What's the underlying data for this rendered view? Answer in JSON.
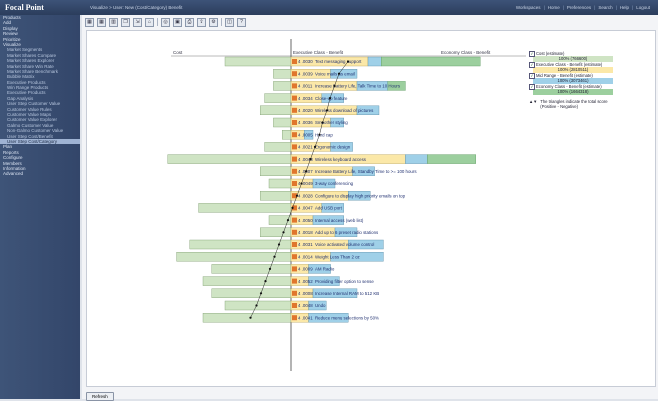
{
  "app": {
    "title": "Focal Point"
  },
  "breadcrumb": "Visualize > User: New (Cost/Category) Benefit",
  "top_links": [
    "Workspaces",
    "Home",
    "Preferences",
    "Search",
    "Help",
    "Logout"
  ],
  "sidebar": [
    {
      "label": "Products",
      "sub": false
    },
    {
      "label": "Add",
      "sub": false
    },
    {
      "label": "Display",
      "sub": false
    },
    {
      "label": "Review",
      "sub": false
    },
    {
      "label": "Prioritize",
      "sub": false
    },
    {
      "label": "Visualize",
      "sub": false
    },
    {
      "label": "Market Segments",
      "sub": true
    },
    {
      "label": "Market Shares Compare",
      "sub": true
    },
    {
      "label": "Market Shares Explorer",
      "sub": true
    },
    {
      "label": "Market Share Win Rate",
      "sub": true
    },
    {
      "label": "Market Share Benchmark",
      "sub": true
    },
    {
      "label": "Bubble Matrix",
      "sub": true
    },
    {
      "label": "Executive Products",
      "sub": true
    },
    {
      "label": "Win Range Products",
      "sub": true
    },
    {
      "label": "Executive Products",
      "sub": true
    },
    {
      "label": "Gap Analysis",
      "sub": true
    },
    {
      "label": "User Step Customer Value",
      "sub": true
    },
    {
      "label": "Customer Value Rules",
      "sub": true
    },
    {
      "label": "Customer Value Maps",
      "sub": true
    },
    {
      "label": "Customer Value Explorer",
      "sub": true
    },
    {
      "label": "Galmo Customer Value",
      "sub": true
    },
    {
      "label": "Non-Galmo Customer Value",
      "sub": true
    },
    {
      "label": "User Step Cost/Benefit",
      "sub": true
    },
    {
      "label": "User Step Cost/Category",
      "sub": true,
      "active": true
    },
    {
      "label": "Plan",
      "sub": false
    },
    {
      "label": "Reports",
      "sub": false
    },
    {
      "label": "Configure",
      "sub": false
    },
    {
      "label": "Members",
      "sub": false
    },
    {
      "label": "Information",
      "sub": false
    },
    {
      "label": "Advanced",
      "sub": false
    }
  ],
  "toolbar_icons": [
    "grid-icon",
    "grid-alt-icon",
    "chart-icon",
    "copy-icon",
    "fit-icon",
    "home-icon",
    "binoculars-icon",
    "save-icon",
    "print-icon",
    "export-icon",
    "settings-icon",
    "window-icon",
    "help-icon"
  ],
  "toolbar_glyphs": [
    "▦",
    "▦",
    "▥",
    "❐",
    "⇲",
    "⌂",
    "◎",
    "▣",
    "⎙",
    "⇪",
    "⚙",
    "◫",
    "?"
  ],
  "legend": {
    "cost": {
      "label": "Cost (estimate)",
      "value": "100% (766600)",
      "color": "#cfe4c4"
    },
    "exec": {
      "label": "Executive Class - Benefit (estimate)",
      "value": "100% (2810511)",
      "color": "#fbe8a8"
    },
    "mid": {
      "label": "Mid Range - Benefit (estimate)",
      "value": "100% (3073461)",
      "color": "#9fd0e8"
    },
    "eco": {
      "label": "Economy Class - Benefit (estimate)",
      "value": "100% (1664318)",
      "color": "#9ccf9e"
    },
    "triangle_note": "The triangles indicate the total score (Positive - Negative)"
  },
  "chart_data": {
    "type": "bar",
    "axis_labels": {
      "cost": "Cost",
      "exec": "Executive Class - Benefit",
      "eco": "Economy Class - Benefit"
    },
    "rows": [
      {
        "code": "4 .0030",
        "label": "Text messaging support",
        "cost": 30,
        "exec": 35,
        "mid": 6,
        "eco": 45,
        "score": 38
      },
      {
        "code": "4 .0039",
        "label": "Voice mails as email",
        "cost": 8,
        "exec": 18,
        "mid": 12,
        "eco": 0,
        "score": 32
      },
      {
        "code": "4 .0011",
        "label": "Increase Battery Life, Talk Time to 10 Hours",
        "cost": 8,
        "exec": 30,
        "mid": 14,
        "eco": 8,
        "score": 29
      },
      {
        "code": "4 .0034",
        "label": "Close-up feature",
        "cost": 12,
        "exec": 14,
        "mid": 10,
        "eco": 0,
        "score": 26
      },
      {
        "code": "4 .0020",
        "label": "Wireless download of pictures",
        "cost": 14,
        "exec": 30,
        "mid": 10,
        "eco": 0,
        "score": 24
      },
      {
        "code": "4 .0036",
        "label": "Smoother styling",
        "cost": 8,
        "exec": 18,
        "mid": 6,
        "eco": 0,
        "score": 21
      },
      {
        "code": "4 .0005",
        "label": "Hard cap",
        "cost": 4,
        "exec": 6,
        "mid": 4,
        "eco": 0,
        "score": 19
      },
      {
        "code": "4 .0021",
        "label": "Ergonomic design",
        "cost": 12,
        "exec": 18,
        "mid": 10,
        "eco": 0,
        "score": 16
      },
      {
        "code": "4 .0043",
        "label": "Wireless keyboard access",
        "cost": 56,
        "exec": 52,
        "mid": 10,
        "eco": 22,
        "score": 13
      },
      {
        "code": "4 .0007",
        "label": "Increase Battery Life, Standby Time to >= 100 hours",
        "cost": 14,
        "exec": 28,
        "mid": 10,
        "eco": 0,
        "score": 10
      },
      {
        "code": "4 .0049",
        "label": "3-way conferencing",
        "cost": 10,
        "exec": 10,
        "mid": 10,
        "eco": 0,
        "score": 7
      },
      {
        "code": "4 .0028",
        "label": "Configure to display high priority emails on top",
        "cost": 14,
        "exec": 26,
        "mid": 10,
        "eco": 0,
        "score": 4
      },
      {
        "code": "4 .0047",
        "label": "Add USB port",
        "cost": 42,
        "exec": 14,
        "mid": 10,
        "eco": 0,
        "score": 1
      },
      {
        "code": "4 .0050",
        "label": "Internal access (web list)",
        "cost": 10,
        "exec": 10,
        "mid": 14,
        "eco": 0,
        "score": -2
      },
      {
        "code": "4 .0018",
        "label": "Add up to 6 preset radio stations",
        "cost": 14,
        "exec": 20,
        "mid": 10,
        "eco": 0,
        "score": -5
      },
      {
        "code": "4 .0031",
        "label": "Voice activated volume control",
        "cost": 46,
        "exec": 26,
        "mid": 16,
        "eco": 0,
        "score": -8
      },
      {
        "code": "4 .0014",
        "label": "Weight Less Than 2 oz",
        "cost": 52,
        "exec": 18,
        "mid": 24,
        "eco": 0,
        "score": -11
      },
      {
        "code": "4 .0009",
        "label": "AM Radio",
        "cost": 36,
        "exec": 8,
        "mid": 10,
        "eco": 0,
        "score": -14
      },
      {
        "code": "4 .0052",
        "label": "Providing filter option to sense",
        "cost": 40,
        "exec": 8,
        "mid": 14,
        "eco": 0,
        "score": -17
      },
      {
        "code": "4 .0008",
        "label": "Increase Internal RAM to 512 KB",
        "cost": 36,
        "exec": 10,
        "mid": 20,
        "eco": 0,
        "score": -20
      },
      {
        "code": "4 .0048",
        "label": "Undo",
        "cost": 30,
        "exec": 8,
        "mid": 8,
        "eco": 0,
        "score": -23
      },
      {
        "code": "4 .0041",
        "label": "Reduce menu selections by 50%",
        "cost": 40,
        "exec": 8,
        "mid": 18,
        "eco": 0,
        "score": -27
      }
    ]
  },
  "footer": {
    "refresh_label": "Refresh"
  }
}
